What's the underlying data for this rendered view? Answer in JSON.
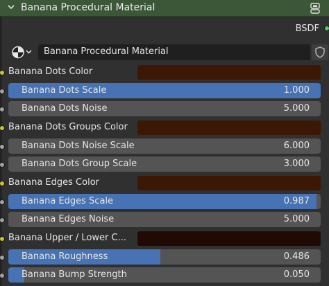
{
  "node": {
    "title": "Banana Procedural Material",
    "output_label": "BSDF",
    "material_name": "Banana Procedural Material"
  },
  "colors": {
    "header_bg": "#3b5738",
    "slider_fill": "#4772b3",
    "slider_bg": "#545454",
    "socket_color": "#c7c729",
    "socket_float": "#a1a1a1",
    "socket_shader": "#55c86a"
  },
  "icons": {
    "collapse": "chevron-down-icon",
    "pin": "node-pin-icon",
    "material": "material-sphere-icon",
    "fake_user": "shield-icon"
  },
  "inputs": [
    {
      "type": "color",
      "label": "Banana Dots Color",
      "color": "#3a1804"
    },
    {
      "type": "slider",
      "label": "Banana Dots Scale",
      "value": "1.000",
      "fill": 1.0
    },
    {
      "type": "slider",
      "label": "Banana Dots Noise",
      "value": "5.000",
      "fill": 0
    },
    {
      "type": "color",
      "label": "Banana Dots Groups Color",
      "color": "#3a1804"
    },
    {
      "type": "slider",
      "label": "Banana Dots Noise Scale",
      "value": "6.000",
      "fill": 0
    },
    {
      "type": "slider",
      "label": "Banana Dots Group Scale",
      "value": "3.000",
      "fill": 0
    },
    {
      "type": "color",
      "label": "Banana Edges Color",
      "color": "#3a1804"
    },
    {
      "type": "slider",
      "label": "Banana Edges Scale",
      "value": "0.987",
      "fill": 0.987
    },
    {
      "type": "slider",
      "label": "Banana Edges Noise",
      "value": "5.000",
      "fill": 0
    },
    {
      "type": "color",
      "label": "Banana Upper / Lower C...",
      "color": "#200b04"
    },
    {
      "type": "slider",
      "label": "Banana Roughness",
      "value": "0.486",
      "fill": 0.486
    },
    {
      "type": "slider",
      "label": "Banana Bump Strength",
      "value": "0.050",
      "fill": 0.05
    }
  ]
}
